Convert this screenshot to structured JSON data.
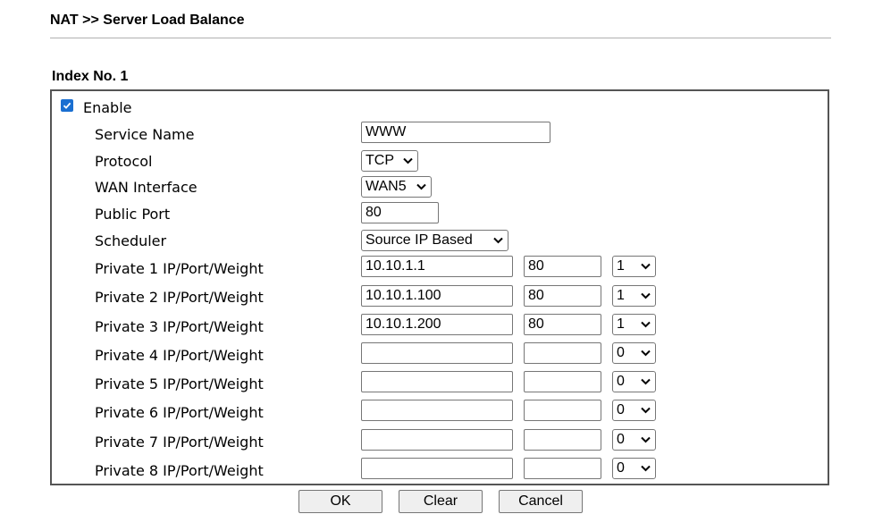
{
  "header": {
    "title": "NAT >> Server Load Balance"
  },
  "index_label": "Index No. 1",
  "enable": {
    "label": "Enable",
    "checked": true
  },
  "fields": {
    "service_name": {
      "label": "Service Name",
      "value": "WWW"
    },
    "protocol": {
      "label": "Protocol",
      "value": "TCP"
    },
    "wan_interface": {
      "label": "WAN Interface",
      "value": "WAN5"
    },
    "public_port": {
      "label": "Public Port",
      "value": "80"
    },
    "scheduler": {
      "label": "Scheduler",
      "value": "Source IP Based"
    }
  },
  "privates": [
    {
      "label": "Private 1 IP/Port/Weight",
      "ip": "10.10.1.1",
      "port": "80",
      "weight": "1"
    },
    {
      "label": "Private 2 IP/Port/Weight",
      "ip": "10.10.1.100",
      "port": "80",
      "weight": "1"
    },
    {
      "label": "Private 3 IP/Port/Weight",
      "ip": "10.10.1.200",
      "port": "80",
      "weight": "1"
    },
    {
      "label": "Private 4 IP/Port/Weight",
      "ip": "",
      "port": "",
      "weight": "0"
    },
    {
      "label": "Private 5 IP/Port/Weight",
      "ip": "",
      "port": "",
      "weight": "0"
    },
    {
      "label": "Private 6 IP/Port/Weight",
      "ip": "",
      "port": "",
      "weight": "0"
    },
    {
      "label": "Private 7 IP/Port/Weight",
      "ip": "",
      "port": "",
      "weight": "0"
    },
    {
      "label": "Private 8 IP/Port/Weight",
      "ip": "",
      "port": "",
      "weight": "0"
    }
  ],
  "buttons": {
    "ok": "OK",
    "clear": "Clear",
    "cancel": "Cancel"
  }
}
